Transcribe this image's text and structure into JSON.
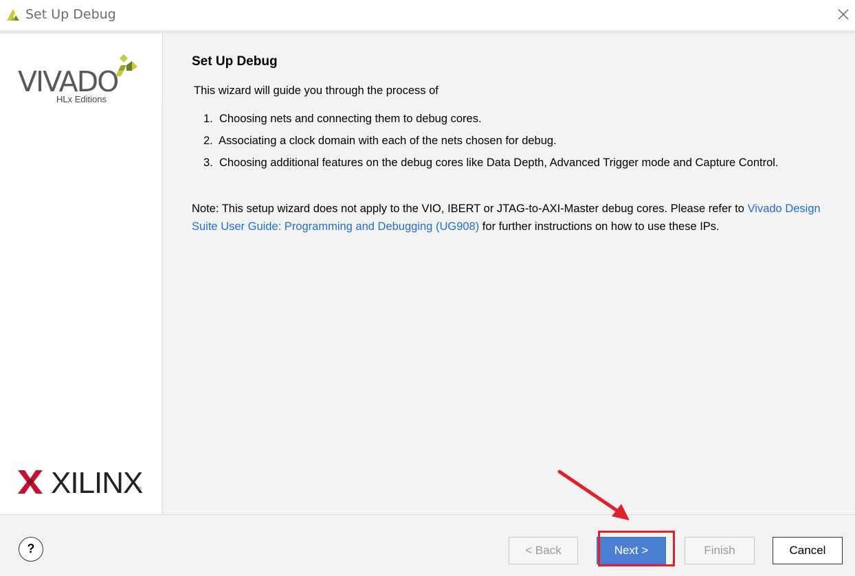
{
  "window": {
    "title": "Set Up Debug",
    "close_icon": "close-icon",
    "app_icon": "vivado-app-icon"
  },
  "sidebar": {
    "vivado_brand": "VIVADO",
    "vivado_subtitle": "HLx Editions",
    "xilinx_brand": "XILINX",
    "xilinx_reg": "®"
  },
  "page": {
    "heading": "Set Up Debug",
    "intro": "This wizard will guide you through the process of",
    "steps": [
      {
        "num": "1.",
        "text": "Choosing nets and connecting them to debug cores."
      },
      {
        "num": "2.",
        "text": "Associating a clock domain with each of the nets chosen for debug."
      },
      {
        "num": "3.",
        "text": "Choosing additional features on the debug cores like Data Depth, Advanced Trigger mode and Capture Control."
      }
    ],
    "note_prefix": "Note: This setup wizard does not apply to the VIO, IBERT or JTAG-to-AXI-Master debug cores. Please refer to ",
    "note_link": "Vivado Design Suite User Guide: Programming and Debugging (UG908)",
    "note_suffix": " for further instructions on how to use these IPs."
  },
  "footer": {
    "help_label": "?",
    "back_label": "< Back",
    "next_label": "Next >",
    "finish_label": "Finish",
    "cancel_label": "Cancel"
  },
  "colors": {
    "accent": "#4a7fd4",
    "link": "#1f6fd6",
    "annotation": "#e0202a"
  }
}
